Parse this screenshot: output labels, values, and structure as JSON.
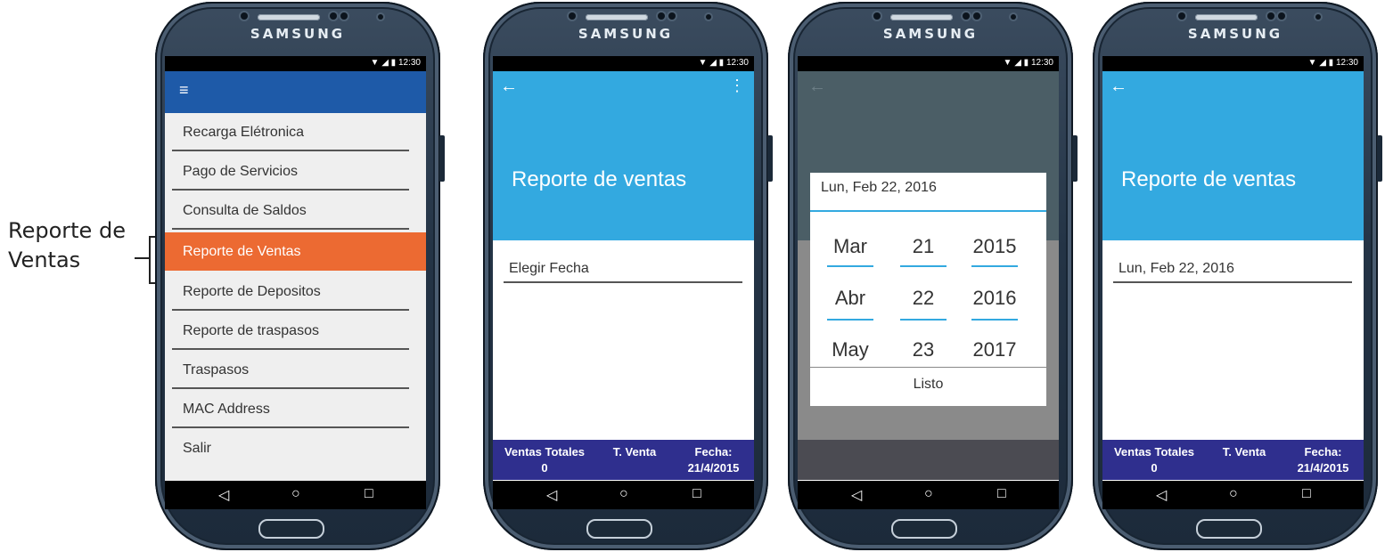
{
  "callout": {
    "text_line1": "Reporte de",
    "text_line2": "Ventas"
  },
  "phone": {
    "brand": "SAMSUNG",
    "status_time": "12:30",
    "status_icons": "▼ ◢ ▮",
    "nav": {
      "back": "◁",
      "home": "○",
      "recent": "□"
    }
  },
  "menu_screen": {
    "hamburger": "≡",
    "items": [
      {
        "label": "Recarga Elétronica"
      },
      {
        "label": "Pago de Servicios"
      },
      {
        "label": "Consulta de Saldos"
      },
      {
        "label": "Reporte de Ventas",
        "active": true
      },
      {
        "label": "Reporte de Depositos"
      },
      {
        "label": "Reporte de traspasos"
      },
      {
        "label": "Traspasos"
      },
      {
        "label": "MAC Address"
      },
      {
        "label": "Salir"
      }
    ]
  },
  "report_screen": {
    "back_arrow": "←",
    "more": "⋮",
    "title": "Reporte de ventas",
    "date_placeholder": "Elegir Fecha",
    "selected_date": "Lun, Feb 22, 2016",
    "footer": {
      "ventas_totales_label": "Ventas Totales",
      "ventas_totales_value": "0",
      "t_venta_label": "T. Venta",
      "fecha_label": "Fecha:",
      "fecha_value": "21/4/2015"
    }
  },
  "date_dialog": {
    "title": "Lun, Feb 22, 2016",
    "months": [
      "Mar",
      "Abr",
      "May"
    ],
    "days": [
      "21",
      "22",
      "23"
    ],
    "years": [
      "2015",
      "2016",
      "2017"
    ],
    "done_label": "Listo"
  },
  "colors": {
    "menu_header": "#1e5aa8",
    "menu_active": "#ec6a32",
    "report_header": "#33a9e0",
    "footer": "#2f2f8e"
  }
}
